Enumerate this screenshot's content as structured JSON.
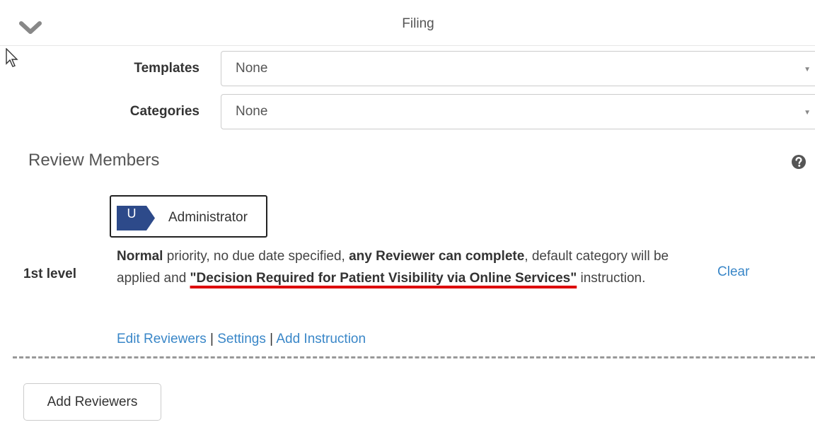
{
  "header": {
    "title": "Filing",
    "collapse_icon": "chevron-down-icon"
  },
  "fields": {
    "templates": {
      "label": "Templates",
      "value": "None",
      "caret": "▼"
    },
    "categories": {
      "label": "Categories",
      "value": "None",
      "caret": "▼"
    }
  },
  "review": {
    "title": "Review Members",
    "help_icon": "question-circle-icon",
    "reviewer": {
      "badge": "U",
      "name": "Administrator",
      "badge_color": "#2d4a8a"
    },
    "level": "1st level",
    "description": {
      "priority": "Normal",
      "text1": " priority, no due date specified, ",
      "completion": "any Reviewer can complete",
      "text2": ", default category will be applied and ",
      "instruction": "\"Decision Required for Patient Visibility via Online Services\"",
      "text3": " instruction."
    },
    "clear_label": "Clear",
    "actions": {
      "edit_reviewers": "Edit Reviewers",
      "settings": "Settings",
      "add_instruction": "Add Instruction",
      "separator": "|"
    }
  },
  "add_reviewers_label": "Add Reviewers",
  "colors": {
    "link": "#3a87c8",
    "highlight_underline": "#dd0000"
  }
}
